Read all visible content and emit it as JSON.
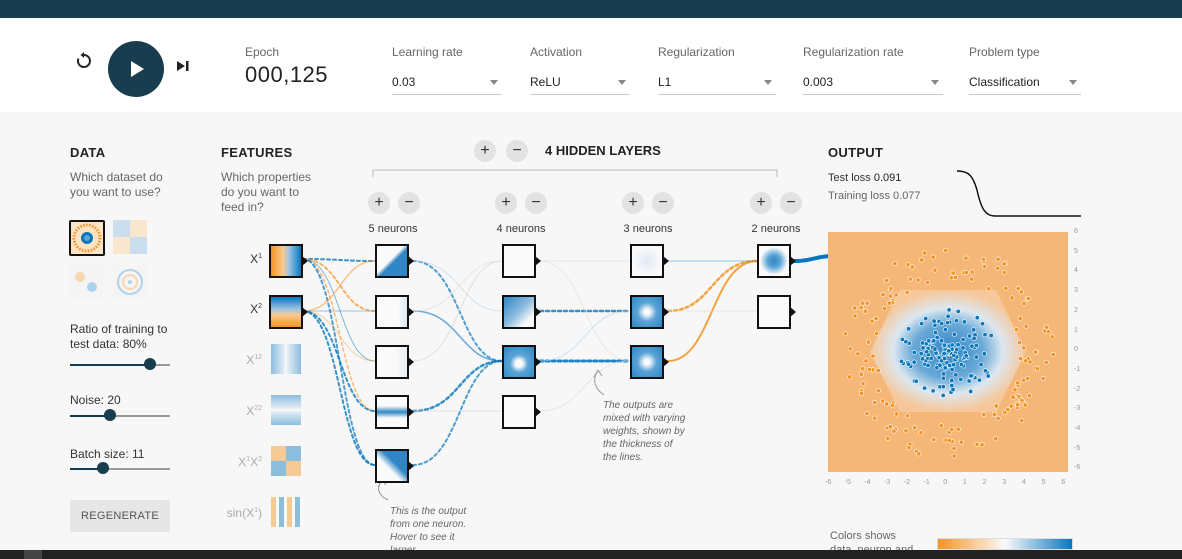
{
  "controls": {
    "epoch_label": "Epoch",
    "epoch_value": "000,125",
    "learning_rate": {
      "label": "Learning rate",
      "value": "0.03"
    },
    "activation": {
      "label": "Activation",
      "value": "ReLU"
    },
    "regularization": {
      "label": "Regularization",
      "value": "L1"
    },
    "regularization_rate": {
      "label": "Regularization rate",
      "value": "0.003"
    },
    "problem_type": {
      "label": "Problem type",
      "value": "Classification"
    }
  },
  "data": {
    "heading": "DATA",
    "question": [
      "Which dataset do",
      "you want to use?"
    ],
    "ratio_label": [
      "Ratio of training to",
      "test data:  80%"
    ],
    "ratio": 0.8,
    "noise_label": "Noise:  20",
    "noise": 0.4,
    "batch_label": "Batch size:  11",
    "batch": 0.33,
    "regenerate": "REGENERATE"
  },
  "features": {
    "heading": "FEATURES",
    "question": [
      "Which properties",
      "do you want to",
      "feed in?"
    ],
    "items": [
      {
        "base": "X",
        "sup": "1",
        "active": true
      },
      {
        "base": "X",
        "sup": "2",
        "active": true
      },
      {
        "base": "X",
        "sup": "12",
        "active": false
      },
      {
        "base": "X",
        "sup": "22",
        "active": false
      },
      {
        "base": "X",
        "sup": "1",
        "base2": "X",
        "sup2": "2",
        "active": false
      },
      {
        "base": "sin(X",
        "sup": "1",
        "tail": ")",
        "active": false
      }
    ]
  },
  "network": {
    "plus": "+",
    "minus": "−",
    "layer_count_label": "4  HIDDEN LAYERS",
    "layers": [
      {
        "label": "5 neurons"
      },
      {
        "label": "4 neurons"
      },
      {
        "label": "3 neurons"
      },
      {
        "label": "2 neurons"
      }
    ],
    "note_neuron": [
      "This is the output",
      "from one neuron.",
      "Hover to see it",
      "larger."
    ],
    "note_weights": [
      "The outputs are",
      "mixed with varying",
      "weights, shown by",
      "the thickness of",
      "the lines."
    ]
  },
  "output": {
    "heading": "OUTPUT",
    "test_loss_label": "Test loss",
    "test_loss": "0.091",
    "train_loss_label": "Training loss",
    "train_loss": "0.077",
    "y_ticks": [
      "6",
      "5",
      "4",
      "3",
      "2",
      "1",
      "0",
      "-1",
      "-2",
      "-3",
      "-4",
      "-5",
      "-6"
    ],
    "x_ticks": [
      "-6",
      "-5",
      "-4",
      "-3",
      "-2",
      "-1",
      "0",
      "1",
      "2",
      "3",
      "4",
      "5",
      "6"
    ],
    "colors_note": [
      "Colors shows",
      "data, neuron and"
    ],
    "colors": {
      "orange": "#f59322",
      "blue": "#0877bd",
      "dark": "#183d4e"
    }
  }
}
